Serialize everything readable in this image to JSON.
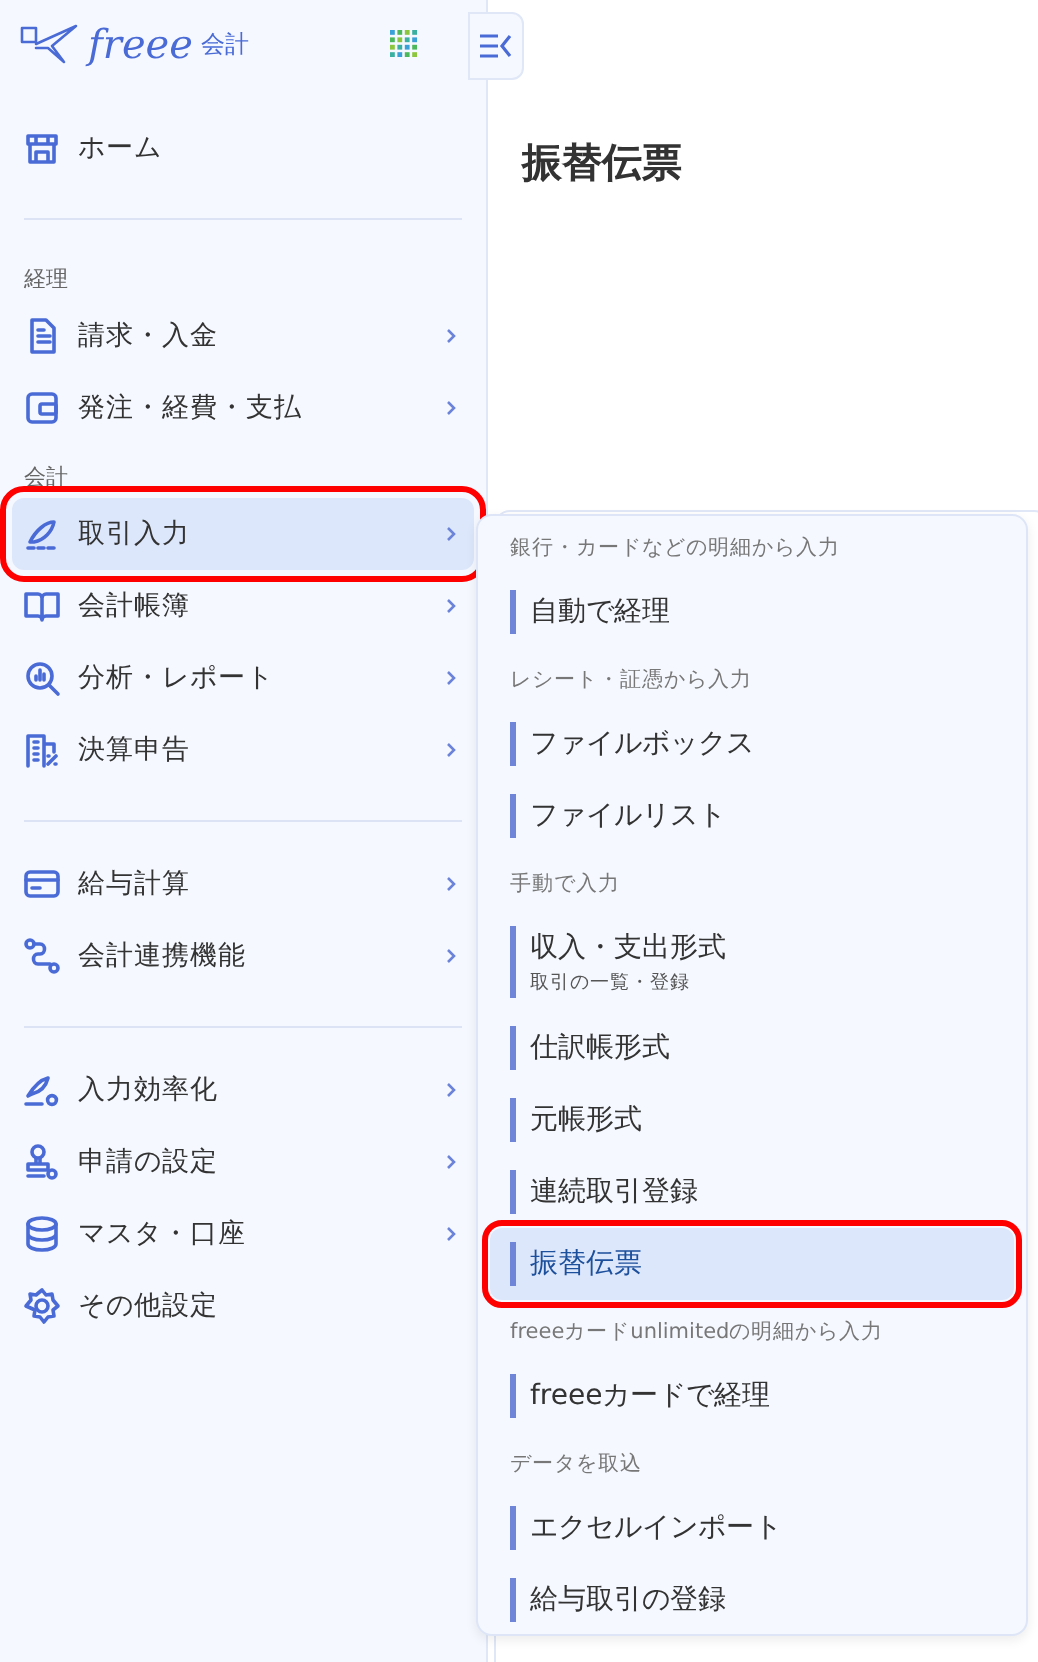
{
  "logo": {
    "wordmark": "freee",
    "product": "会計"
  },
  "sidebar": {
    "sections": [
      {
        "items": [
          {
            "label": "ホーム",
            "has_submenu": false,
            "selected": false,
            "highlighted": false
          }
        ]
      },
      {
        "divider_above": true,
        "heading": "経理",
        "items": [
          {
            "label": "請求・入金",
            "has_submenu": true,
            "selected": false,
            "highlighted": false
          },
          {
            "label": "発注・経費・支払",
            "has_submenu": true,
            "selected": false,
            "highlighted": false
          }
        ]
      },
      {
        "heading": "会計",
        "items": [
          {
            "label": "取引入力",
            "has_submenu": true,
            "selected": true,
            "highlighted": true
          },
          {
            "label": "会計帳簿",
            "has_submenu": true,
            "selected": false,
            "highlighted": false
          },
          {
            "label": "分析・レポート",
            "has_submenu": true,
            "selected": false,
            "highlighted": false
          },
          {
            "label": "決算申告",
            "has_submenu": true,
            "selected": false,
            "highlighted": false
          }
        ]
      },
      {
        "divider_above": true,
        "items": [
          {
            "label": "給与計算",
            "has_submenu": true,
            "selected": false,
            "highlighted": false
          },
          {
            "label": "会計連携機能",
            "has_submenu": true,
            "selected": false,
            "highlighted": false
          }
        ]
      },
      {
        "divider_above": true,
        "items": [
          {
            "label": "入力効率化",
            "has_submenu": true,
            "selected": false,
            "highlighted": false
          },
          {
            "label": "申請の設定",
            "has_submenu": true,
            "selected": false,
            "highlighted": false
          },
          {
            "label": "マスタ・口座",
            "has_submenu": true,
            "selected": false,
            "highlighted": false
          },
          {
            "label": "その他設定",
            "has_submenu": false,
            "selected": false,
            "highlighted": false
          }
        ]
      }
    ]
  },
  "page": {
    "title": "振替伝票"
  },
  "flyout": {
    "groups": [
      {
        "heading": "銀行・カードなどの明細から入力",
        "items": [
          {
            "label": "自動で経理",
            "selected": false,
            "highlighted": false
          }
        ]
      },
      {
        "heading": "レシート・証憑から入力",
        "items": [
          {
            "label": "ファイルボックス",
            "selected": false,
            "highlighted": false
          },
          {
            "label": "ファイルリスト",
            "selected": false,
            "highlighted": false
          }
        ]
      },
      {
        "heading": "手動で入力",
        "items": [
          {
            "label": "収入・支出形式",
            "sub": "取引の一覧・登録",
            "selected": false,
            "highlighted": false
          },
          {
            "label": "仕訳帳形式",
            "selected": false,
            "highlighted": false
          },
          {
            "label": "元帳形式",
            "selected": false,
            "highlighted": false
          },
          {
            "label": "連続取引登録",
            "selected": false,
            "highlighted": false
          },
          {
            "label": "振替伝票",
            "selected": true,
            "highlighted": true
          }
        ]
      },
      {
        "heading": "freeeカードunlimitedの明細から入力",
        "items": [
          {
            "label": "freeeカードで経理",
            "selected": false,
            "highlighted": false
          }
        ]
      },
      {
        "heading": "データを取込",
        "items": [
          {
            "label": "エクセルインポート",
            "selected": false,
            "highlighted": false
          },
          {
            "label": "給与取引の登録",
            "selected": false,
            "highlighted": false
          }
        ]
      }
    ]
  }
}
